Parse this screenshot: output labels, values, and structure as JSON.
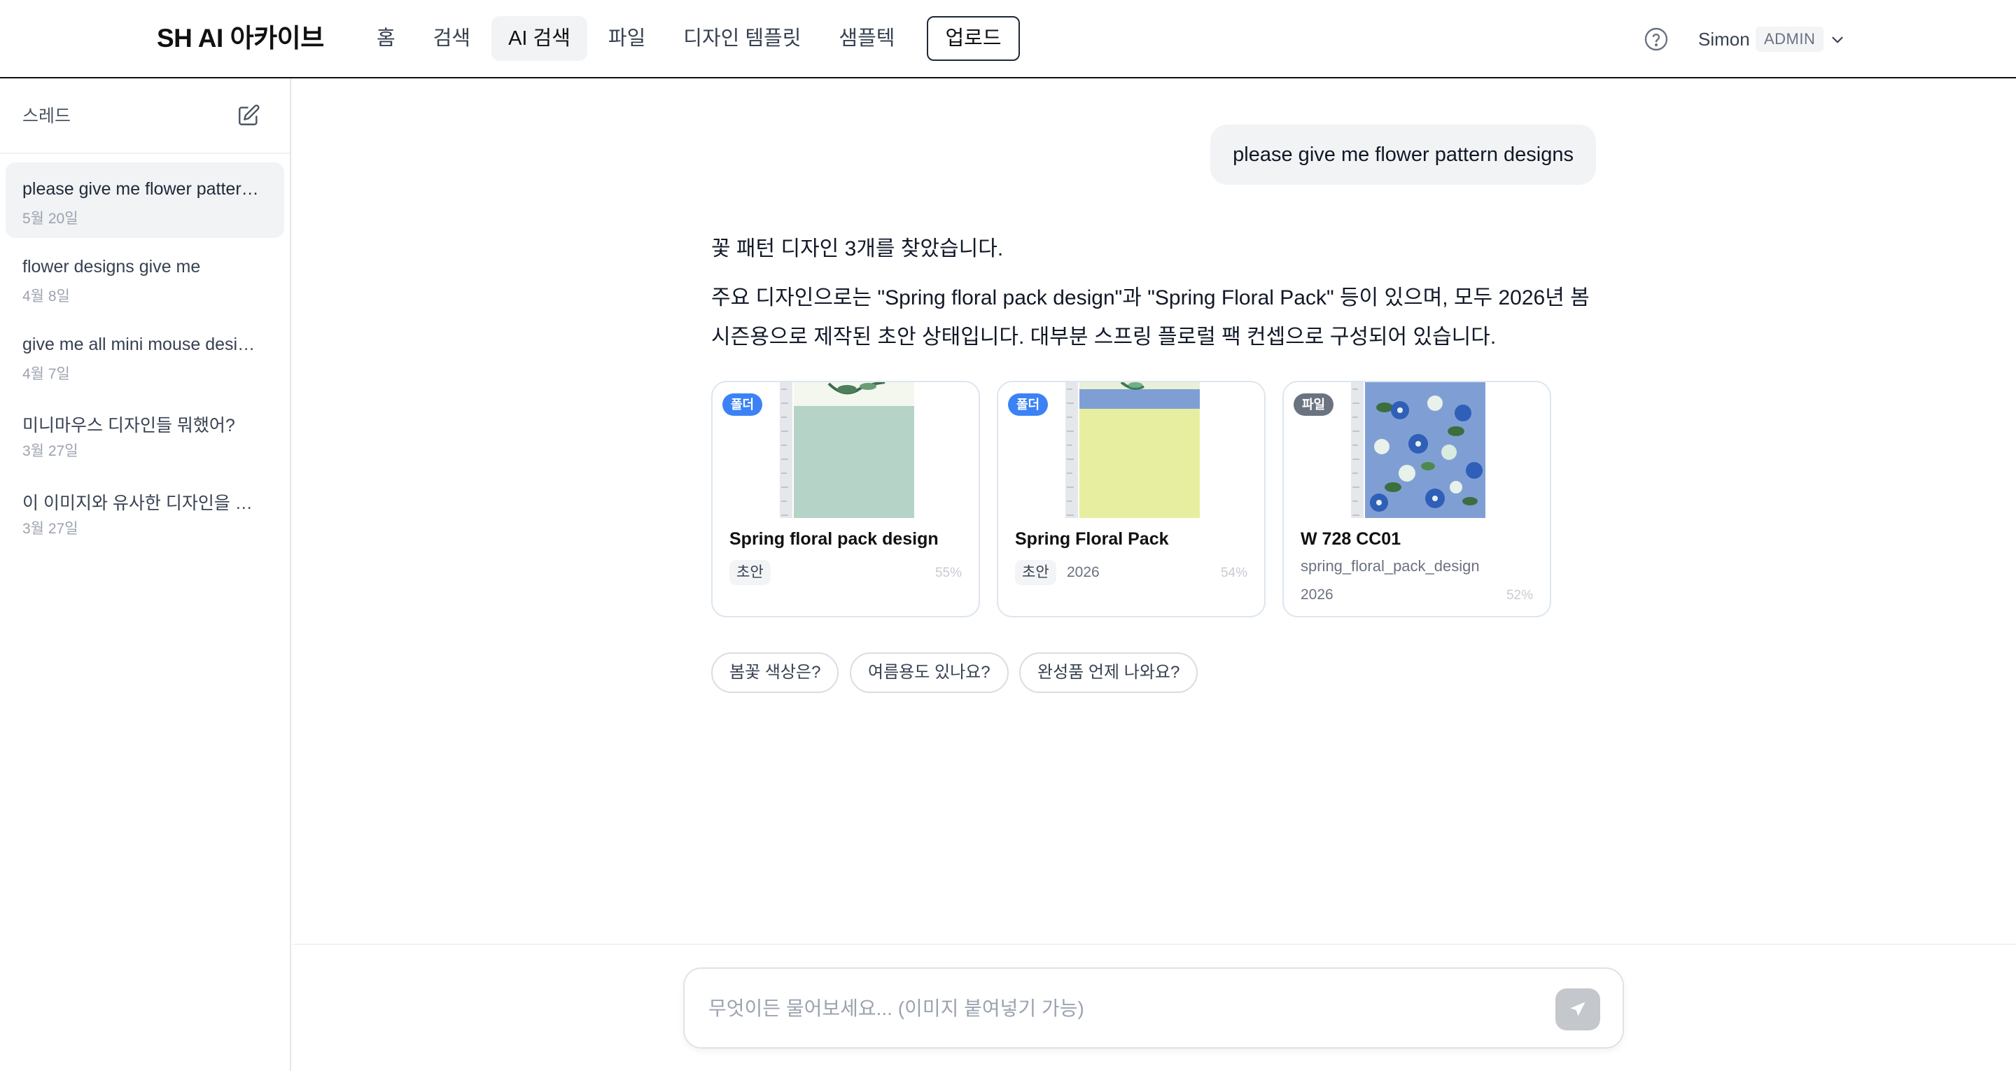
{
  "header": {
    "logo": "SH AI 아카이브",
    "nav": [
      {
        "label": "홈"
      },
      {
        "label": "검색"
      },
      {
        "label": "AI 검색"
      },
      {
        "label": "파일"
      },
      {
        "label": "디자인 템플릿"
      },
      {
        "label": "샘플텍"
      },
      {
        "label": "업로드"
      }
    ],
    "active_nav": "AI 검색",
    "user": {
      "name": "Simon",
      "role": "ADMIN"
    }
  },
  "sidebar": {
    "title": "스레드",
    "threads": [
      {
        "title": "please give me flower pattern designs",
        "date": "5월 20일",
        "active": true
      },
      {
        "title": "flower designs give me",
        "date": "4월 8일"
      },
      {
        "title": "give me all mini mouse designs",
        "date": "4월 7일"
      },
      {
        "title": "미니마우스 디자인들 뭐했어?",
        "date": "3월 27일"
      },
      {
        "title": "이 이미지와 유사한 디자인을 찾아줘",
        "date": "3월 27일"
      }
    ]
  },
  "conversation": {
    "user_message": "please give me flower pattern designs",
    "answer_line1": "꽃 패턴 디자인 3개를 찾았습니다.",
    "answer_line2": "주요 디자인으로는 \"Spring floral pack design\"과 \"Spring Floral Pack\" 등이 있으며, 모두 2026년 봄 시즌용으로 제작된 초안 상태입니다. 대부분 스프링 플로럴 팩 컨셉으로 구성되어 있습니다.",
    "results": [
      {
        "badge": "폴더",
        "title": "Spring floral pack design",
        "tag": "초안",
        "year": "",
        "score": "55%"
      },
      {
        "badge": "폴더",
        "title": "Spring Floral Pack",
        "tag": "초안",
        "year": "2026",
        "score": "54%"
      },
      {
        "badge": "파일",
        "title": "W 728 CC01",
        "subtitle": "spring_floral_pack_design",
        "year": "2026",
        "score": "52%"
      }
    ],
    "suggestions": [
      "봄꽃 색상은?",
      "여름용도 있나요?",
      "완성품 언제 나와요?"
    ]
  },
  "composer": {
    "placeholder": "무엇이든 물어보세요... (이미지 붙여넣기 가능)"
  },
  "colors": {
    "accent_badge_folder": "#3b82f6",
    "badge_file": "#6b7280",
    "thumb_mint": "#b5d3c6",
    "thumb_yellow": "#e8eea0",
    "thumb_blue": "#7f9fd4"
  },
  "icons": [
    "help-circle-icon",
    "chevron-down-icon",
    "new-thread-icon",
    "send-icon"
  ]
}
